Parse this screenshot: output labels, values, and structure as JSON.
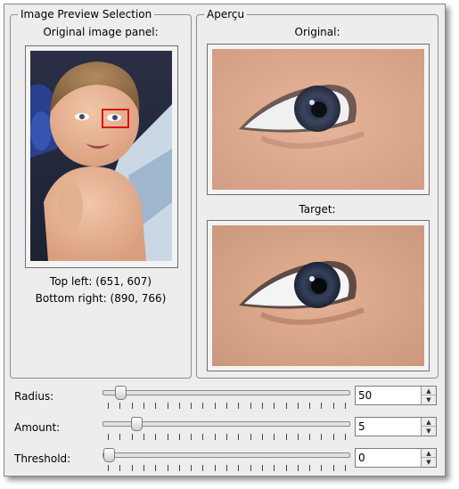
{
  "left_panel": {
    "title": "Image Preview Selection",
    "panel_label": "Original image panel:",
    "top_left": "Top left: (651, 607)",
    "bottom_right": "Bottom right: (890, 766)"
  },
  "right_panel": {
    "title": "Aperçu",
    "original_label": "Original:",
    "target_label": "Target:"
  },
  "controls": [
    {
      "label": "Radius:",
      "value": "50",
      "fraction": 0.05
    },
    {
      "label": "Amount:",
      "value": "5",
      "fraction": 0.115
    },
    {
      "label": "Threshold:",
      "value": "0",
      "fraction": 0.0
    }
  ],
  "colors": {
    "selection": "#e01010"
  },
  "icons": {
    "spin_up": "arrow-up-icon",
    "spin_down": "arrow-down-icon"
  }
}
